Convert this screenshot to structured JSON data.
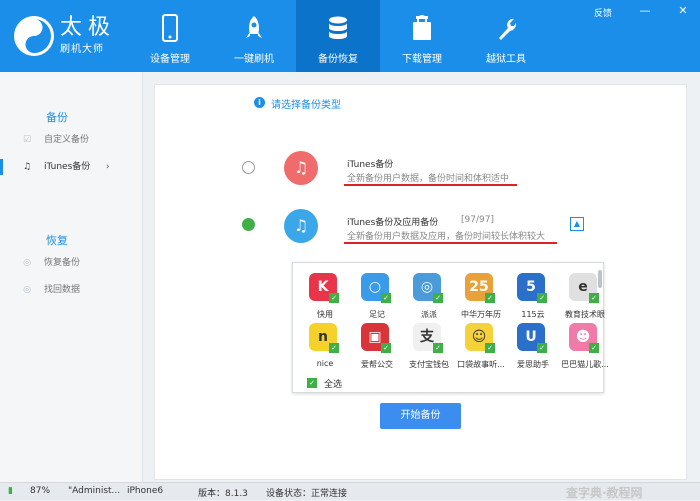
{
  "app": {
    "title": "太极",
    "subtitle": "刷机大师",
    "feedback": "反馈"
  },
  "nav": [
    {
      "label": "设备管理",
      "icon": "phone-icon"
    },
    {
      "label": "一键刷机",
      "icon": "rocket-icon"
    },
    {
      "label": "备份恢复",
      "icon": "database-icon",
      "active": true
    },
    {
      "label": "下载管理",
      "icon": "shopping-bag-icon"
    },
    {
      "label": "越狱工具",
      "icon": "wrench-icon"
    }
  ],
  "sidebar": {
    "backup_title": "备份",
    "backup_items": [
      {
        "label": "自定义备份"
      },
      {
        "label": "iTunes备份",
        "chevron": "›"
      }
    ],
    "restore_title": "恢复",
    "restore_items": [
      {
        "label": "恢复备份"
      },
      {
        "label": "找回数据"
      }
    ]
  },
  "main": {
    "header": "请选择备份类型",
    "options": [
      {
        "title": "iTunes备份",
        "desc": "全新备份用户数据，备份时间和体积适中",
        "selected": false
      },
      {
        "title": "iTunes备份及应用备份",
        "count": "[97/97]",
        "desc": "全新备份用户数据及应用，备份时间较长体积较大",
        "selected": true
      }
    ],
    "apps": [
      {
        "name": "快用",
        "color": "#e8354a",
        "glyph": "K"
      },
      {
        "name": "足记",
        "color": "#3a9be8",
        "glyph": "○"
      },
      {
        "name": "派派",
        "color": "#4a9bd8",
        "glyph": "◎"
      },
      {
        "name": "中华万年历",
        "color": "#e8a23a",
        "glyph": "25"
      },
      {
        "name": "115云",
        "color": "#2a6fc9",
        "glyph": "5"
      },
      {
        "name": "教育技术眼",
        "color": "#e0e0e0",
        "glyph": "e"
      },
      {
        "name": "nice",
        "color": "#f5d22a",
        "glyph": "n"
      },
      {
        "name": "爱帮公交",
        "color": "#d9343a",
        "glyph": "▣"
      },
      {
        "name": "支付宝钱包",
        "color": "#f0f0f0",
        "glyph": "支"
      },
      {
        "name": "口袋故事听...",
        "color": "#f5d23a",
        "glyph": "☺"
      },
      {
        "name": "爱思助手",
        "color": "#2a6fc9",
        "glyph": "U"
      },
      {
        "name": "巴巴猫儿歌...",
        "color": "#f07aa8",
        "glyph": "☻"
      }
    ],
    "select_all": "全选",
    "start_button": "开始备份"
  },
  "status": {
    "battery": "87%",
    "device_name": "\"Administ...",
    "model": "iPhone6",
    "version": "版本：8.1.3",
    "state": "设备状态：正常连接"
  },
  "colors": {
    "primary": "#1a8ee8",
    "accent": "#3fb047",
    "underline": "#d9242b"
  }
}
